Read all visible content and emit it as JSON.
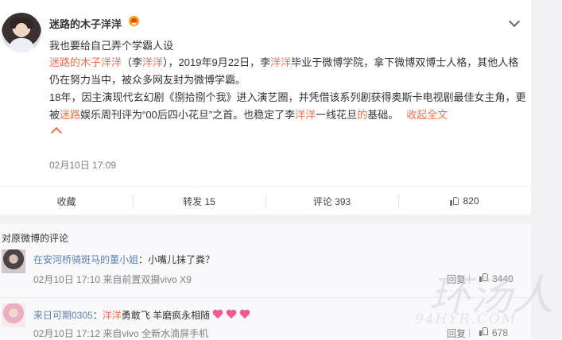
{
  "post": {
    "user_name": "迷路的木子洋洋",
    "subtitle": "我也要给自己弄个学霸人设",
    "content": {
      "p1": [
        {
          "text": "迷路的木子洋洋",
          "hl": true
        },
        {
          "text": "（李",
          "hl": false
        },
        {
          "text": "洋洋",
          "hl": true
        },
        {
          "text": "），2019年9月22日，李",
          "hl": false
        },
        {
          "text": "洋洋",
          "hl": true
        },
        {
          "text": "毕业于微博学院，拿下微博双博士人格，其他人格仍在努力当中，被众多网友封为微博学霸。",
          "hl": false
        }
      ],
      "p2": [
        {
          "text": "18年，因主演现代玄幻剧《捌拾捌个我》进入演艺圈，并凭借该系列剧获得奥斯卡电视剧最佳女主角，更被",
          "hl": false
        },
        {
          "text": "迷路",
          "hl": true
        },
        {
          "text": "娱乐周刊评为“00后四小花旦”之首。也稳定了李",
          "hl": false
        },
        {
          "text": "洋洋",
          "hl": true
        },
        {
          "text": "一线花旦",
          "hl": false
        },
        {
          "text": "的",
          "hl": true
        },
        {
          "text": "基础。",
          "hl": false
        }
      ],
      "collapse_label": "收起全文"
    },
    "time": "02月10日 17:09"
  },
  "toolbar": {
    "favorite": "收藏",
    "repost": "转发 15",
    "comment": "评论 393",
    "like": "820"
  },
  "comments": {
    "title": "对原微博的评论",
    "items": [
      {
        "user": "在安河桥骑斑马的董小姐",
        "separator": "：",
        "text_parts": [
          {
            "text": "小嘴儿抹了粪？",
            "hl": false
          }
        ],
        "meta": "02月10日 17:10 来自前置双摄vivo X9",
        "reply": "回复",
        "likes": "3440"
      },
      {
        "user": "来日可期0305",
        "separator": "：",
        "text_parts": [
          {
            "text": "洋洋",
            "hl": true
          },
          {
            "text": "勇敢飞 羊磨疯永相随",
            "hl": false
          }
        ],
        "meta": "02月10日 17:12 来自vivo 全新水滴屏手机",
        "reply": "回复",
        "likes": "678"
      }
    ]
  },
  "watermark": {
    "big": "环汤人",
    "small": "94HYR.COM"
  },
  "colors": {
    "highlight": "#eb7350",
    "user_link": "#5b7fae",
    "muted": "#808080"
  }
}
